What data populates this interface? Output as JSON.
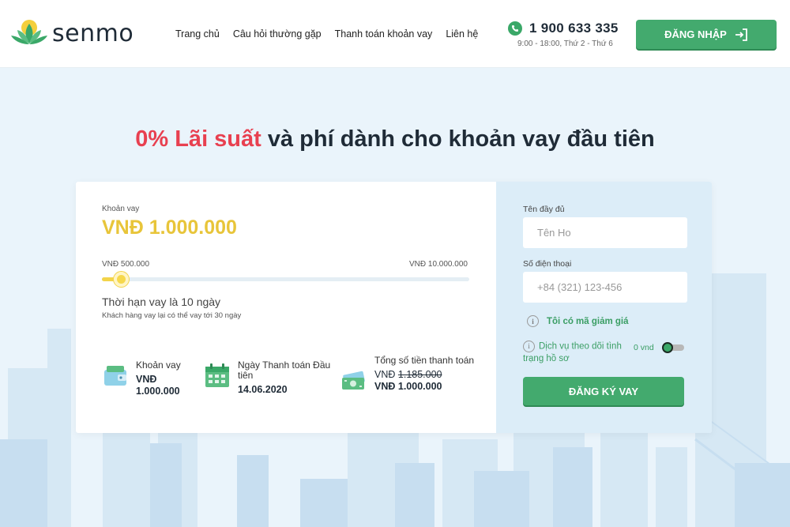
{
  "brand": {
    "name": "senmo",
    "accent": "#43aa6e",
    "highlight_red": "#e84050",
    "amount_yellow": "#e8c53a"
  },
  "nav": {
    "items": [
      {
        "label": "Trang chủ"
      },
      {
        "label": "Câu hỏi thường gặp"
      },
      {
        "label": "Thanh toán khoản vay"
      },
      {
        "label": "Liên hệ"
      }
    ]
  },
  "contact": {
    "phone": "1 900 633 335",
    "hours": "9:00 - 18:00, Thứ 2 - Thứ 6",
    "icon": "phone-icon"
  },
  "header": {
    "login_label": "ĐĂNG NHẬP",
    "login_icon": "login-arrow-icon"
  },
  "headline": {
    "highlight": "0% Lãi suất",
    "rest": " và phí dành cho khoản vay đầu tiên"
  },
  "loan": {
    "label": "Khoản vay",
    "amount": "VNĐ 1.000.000",
    "min_label": "VNĐ 500.000",
    "max_label": "VNĐ 10.000.000",
    "slider_fraction": 0.05,
    "term": "Thời hạn vay là 10 ngày",
    "term_note": "Khách hàng vay lại có thể vay tới 30 ngày"
  },
  "summary": {
    "loan": {
      "title": "Khoản vay",
      "value": "VNĐ 1.000.000",
      "icon": "wallet-icon"
    },
    "date": {
      "title": "Ngày Thanh toán Đầu tiên",
      "value": "14.06.2020",
      "icon": "calendar-icon"
    },
    "total": {
      "title": "Tổng số tiền thanh toán",
      "currency": "VNĐ",
      "old_value": "1.185.000",
      "value": "VNĐ 1.000.000",
      "icon": "money-icon"
    }
  },
  "form": {
    "name_label": "Tên đầy đủ",
    "name_placeholder": "Tên Ho",
    "phone_label": "Số điện thoại",
    "phone_placeholder": "+84 (321) 123-456",
    "promo_label": "Tôi có mã giảm giá",
    "tracking_label": "Dịch vụ theo dõi tình trạng hồ sơ",
    "tracking_price": "0 vnd",
    "tracking_enabled": false,
    "submit_label": "ĐĂNG KÝ VAY"
  }
}
